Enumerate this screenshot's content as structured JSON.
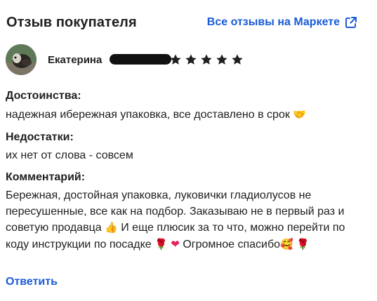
{
  "header": {
    "title": "Отзыв покупателя",
    "all_reviews_link": "Все отзывы на Маркете"
  },
  "author": {
    "name": "Екатерина",
    "rating": 5,
    "max_rating": 5
  },
  "review": {
    "pros_label": "Достоинства:",
    "pros_text": "надежная ибережная упаковка, все доставлено в срок",
    "pros_emoji": "🤝",
    "cons_label": "Недостатки:",
    "cons_text": "их нет от слова - совсем",
    "comment_label": "Комментарий:",
    "comment_part1": "Бережная, достойная упаковка, луковички гладиолусов не пересушенные, все как на подбор. Заказываю не в первый раз и советую продавца",
    "comment_emoji1": "👍",
    "comment_part2": "И еще плюсик за то что, можно перейти по коду инструкции по посадке",
    "comment_emoji2": "🌹",
    "comment_emoji3": "❤",
    "comment_part3": "Огромное спасибо",
    "comment_emoji4": "🥰",
    "comment_emoji5": "🌹"
  },
  "actions": {
    "reply_label": "Ответить"
  },
  "colors": {
    "link": "#1a5bd8",
    "text": "#21201f",
    "star": "#21201f",
    "emoji_rose": "#d1263a",
    "emoji_heart": "#e0245e",
    "emoji_hand": "#f4b400"
  }
}
